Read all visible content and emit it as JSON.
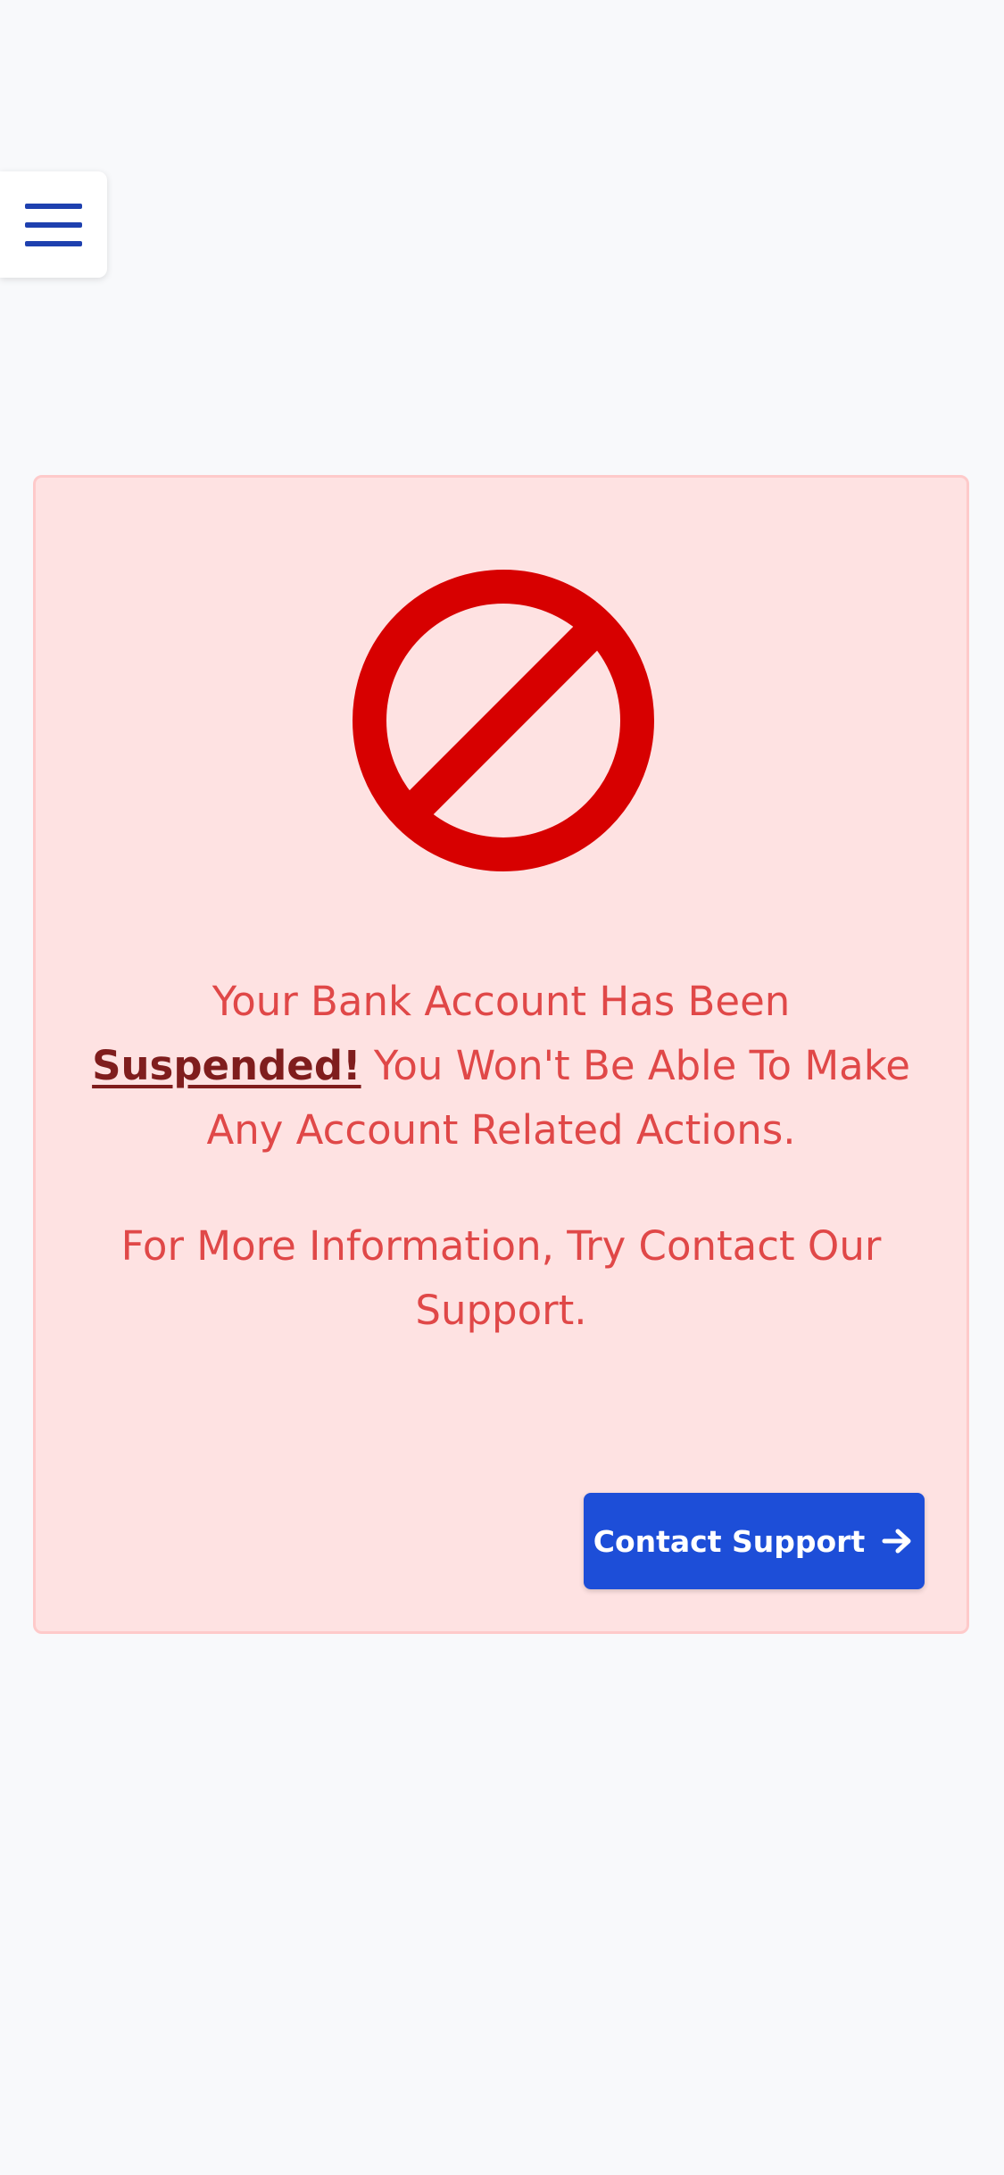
{
  "menu": {
    "icon": "hamburger-menu-icon",
    "color": "#1e40af"
  },
  "alert": {
    "icon": "ban-icon",
    "icon_color": "#d70000",
    "background": "#fee2e2",
    "text_color": "#e04848",
    "line1_prefix": "Your Bank Account Has Been ",
    "line1_emphasis": "Suspended!",
    "line1_suffix": " You Won't Be Able To Make Any Account Related Actions.",
    "line2": "For More Information, Try Contact Our Support."
  },
  "contact_button": {
    "label": "Contact Support",
    "icon": "arrow-right-icon",
    "background": "#1d4ed8"
  }
}
